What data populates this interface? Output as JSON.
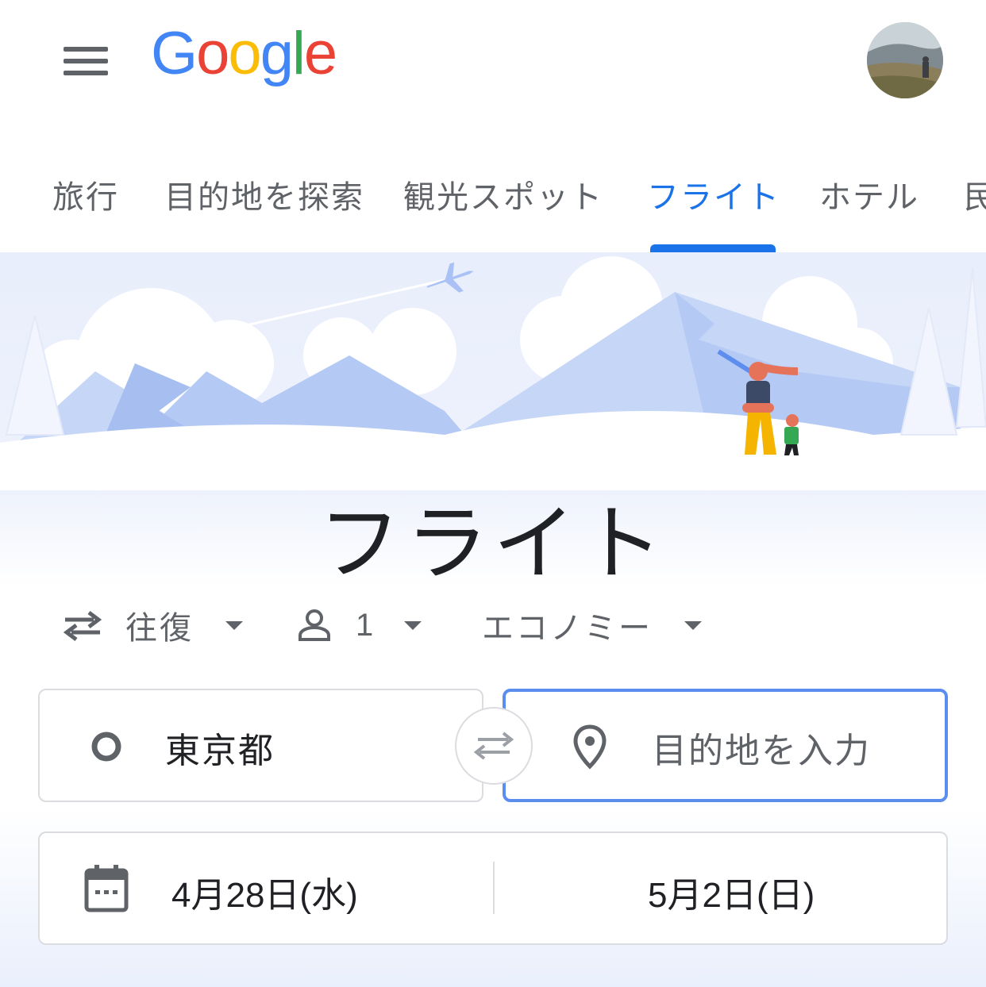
{
  "header": {
    "logo_letters": [
      "G",
      "o",
      "o",
      "g",
      "l",
      "e"
    ],
    "logo_colors": [
      "#4285F4",
      "#EA4335",
      "#FBBC05",
      "#4285F4",
      "#34A853",
      "#EA4335"
    ]
  },
  "tabs": [
    {
      "label": "旅行"
    },
    {
      "label": "目的地を探索"
    },
    {
      "label": "観光スポット"
    },
    {
      "label": "フライト"
    },
    {
      "label": "ホテル"
    },
    {
      "label": "民"
    }
  ],
  "active_tab": "フライト",
  "hero": {
    "title": "フライト"
  },
  "options": {
    "trip_type": "往復",
    "passengers": "1",
    "cabin_class": "エコノミー"
  },
  "search": {
    "origin": "東京都",
    "destination_placeholder": "目的地を入力",
    "depart_date": "4月28日(水)",
    "return_date": "5月2日(日)"
  },
  "colors": {
    "accent": "#1a73e8",
    "text_secondary": "#5f6368",
    "hero_bg": "#e8eefb"
  }
}
